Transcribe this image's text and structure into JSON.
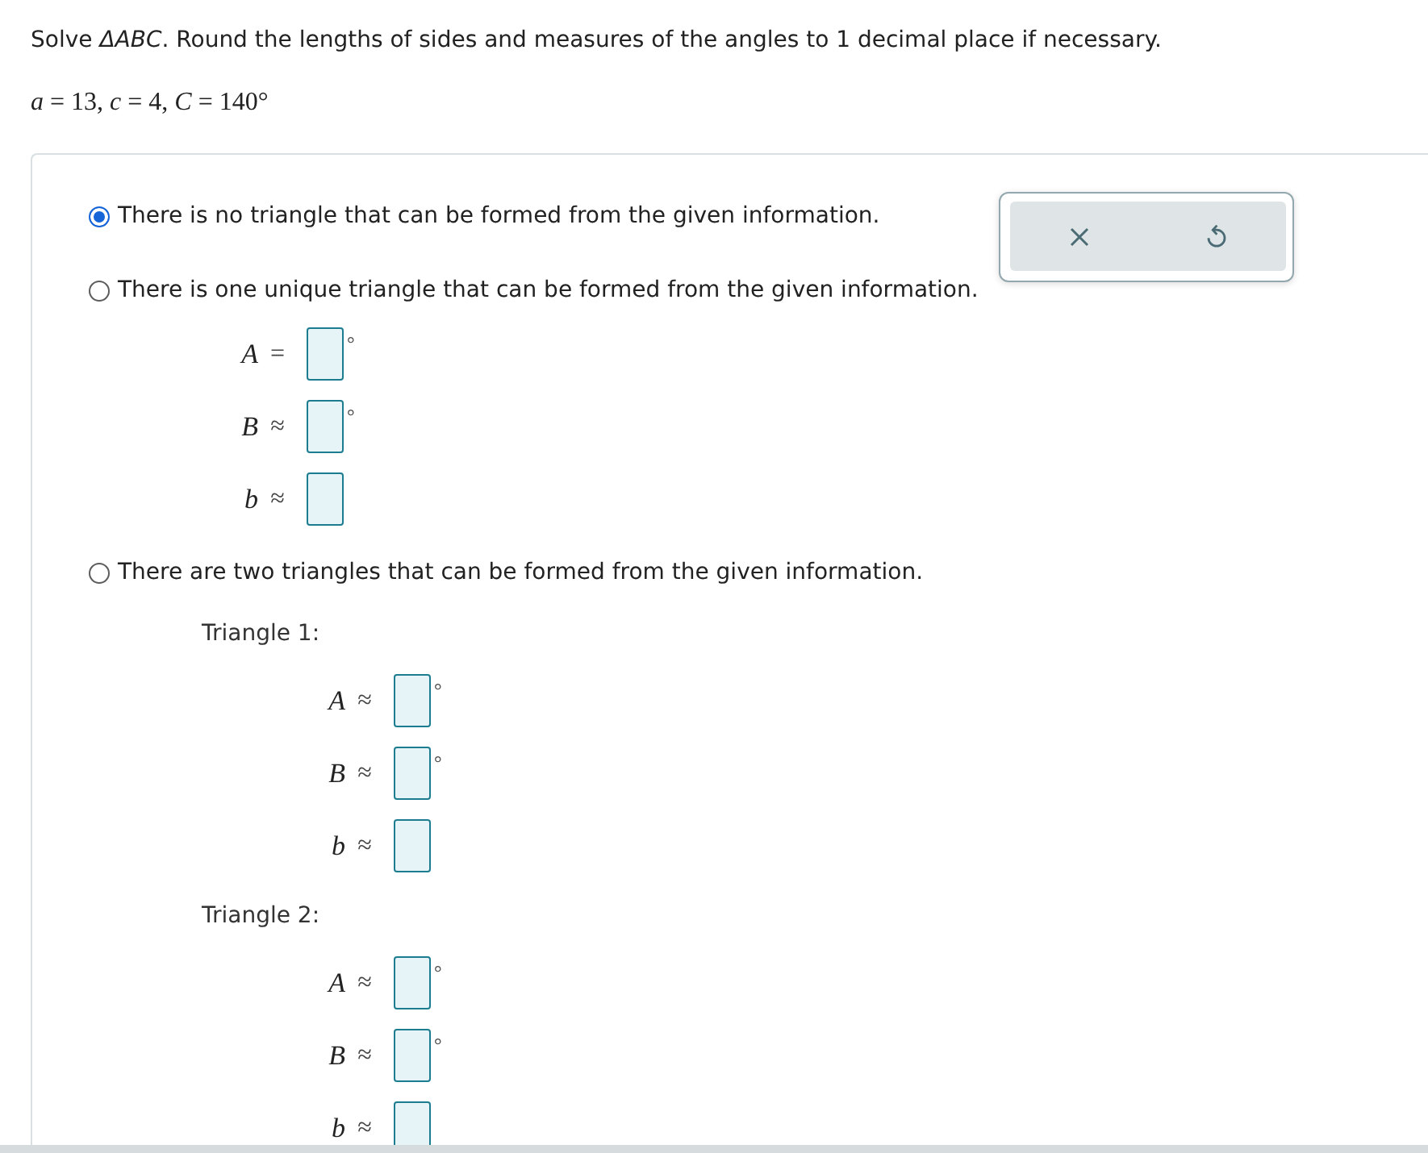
{
  "question": {
    "prompt": "Solve *ΔABC*. Round the lengths of sides and measures of the angles to 1 decimal place if necessary.",
    "given": "*a* = 13, *c* = 4, *C* = 140°"
  },
  "options": [
    {
      "label": "There is no triangle that can be formed from the given information.",
      "selected": true
    },
    {
      "label": "There is one unique triangle that can be formed from the given information.",
      "selected": false,
      "fields": [
        {
          "variable": "A",
          "relation": "=",
          "unit": "°"
        },
        {
          "variable": "B",
          "relation": "≈",
          "unit": "°"
        },
        {
          "variable": "b",
          "relation": "≈"
        }
      ]
    },
    {
      "label": "There are two triangles that can be formed from the given information.",
      "selected": false,
      "triangles": [
        {
          "title": "Triangle 1:",
          "fields": [
            {
              "variable": "A",
              "relation": "≈",
              "unit": "°"
            },
            {
              "variable": "B",
              "relation": "≈",
              "unit": "°"
            },
            {
              "variable": "b",
              "relation": "≈"
            }
          ]
        },
        {
          "title": "Triangle 2:",
          "fields": [
            {
              "variable": "A",
              "relation": "≈",
              "unit": "°"
            },
            {
              "variable": "B",
              "relation": "≈",
              "unit": "°"
            },
            {
              "variable": "b",
              "relation": "≈"
            }
          ]
        }
      ]
    }
  ]
}
